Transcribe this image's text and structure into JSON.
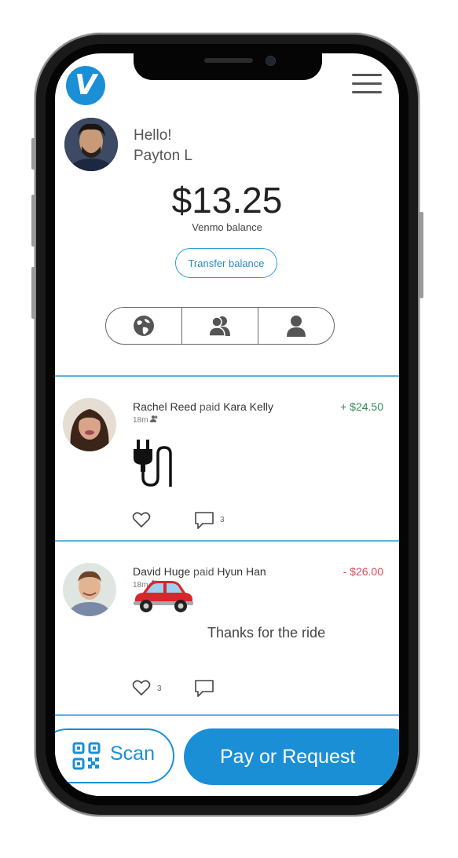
{
  "app": {
    "logo_letter": "V",
    "brand_color": "#1a8fd6"
  },
  "profile": {
    "greeting": "Hello!",
    "name": "Payton L"
  },
  "balance": {
    "amount": "$13.25",
    "label": "Venmo balance",
    "transfer_button": "Transfer balance"
  },
  "feed_tabs": [
    {
      "icon": "globe-icon"
    },
    {
      "icon": "friends-icon"
    },
    {
      "icon": "person-icon"
    }
  ],
  "feed": [
    {
      "payer": "Rachel Reed",
      "verb": "paid",
      "payee": "Kara Kelly",
      "time": "18m",
      "amount": "+ $24.50",
      "note_icon": "electric-plug-icon",
      "note_text": "",
      "like_count": "",
      "comment_count": "3"
    },
    {
      "payer": "David Huge",
      "verb": "paid",
      "payee": "Hyun Han",
      "time": "18m",
      "amount": "- $26.00",
      "note_icon": "car-icon",
      "note_text": "Thanks for the ride",
      "like_count": "3",
      "comment_count": ""
    }
  ],
  "bottom": {
    "scan_label": "Scan",
    "pay_label": "Pay or Request"
  },
  "colors": {
    "positive": "#2e8b57",
    "negative": "#d24b5a",
    "divider": "#5bb4d8"
  }
}
